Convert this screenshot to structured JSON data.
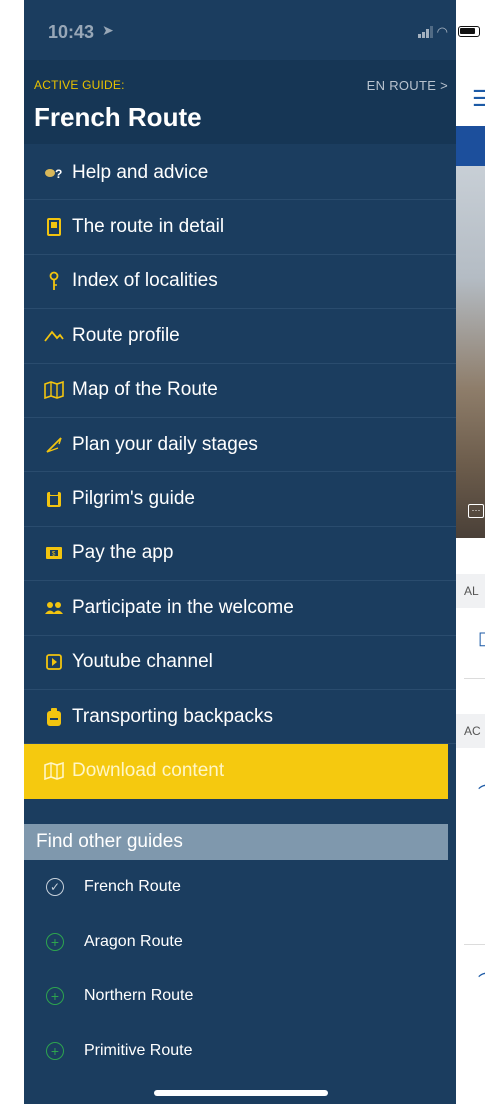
{
  "status_bar": {
    "time": "10:43"
  },
  "header": {
    "active_label": "ACTIVE GUIDE:",
    "en_route": "EN ROUTE >",
    "title": "French Route"
  },
  "menu": [
    {
      "label": "Help and advice",
      "icon": "help-icon"
    },
    {
      "label": "The route in detail",
      "icon": "route-detail-icon"
    },
    {
      "label": "Index of localities",
      "icon": "location-pin-icon"
    },
    {
      "label": "Route profile",
      "icon": "profile-icon"
    },
    {
      "label": "Map of the Route",
      "icon": "map-icon"
    },
    {
      "label": "Plan your daily stages",
      "icon": "plan-icon"
    },
    {
      "label": "Pilgrim's guide",
      "icon": "clipboard-icon"
    },
    {
      "label": "Pay the app",
      "icon": "money-icon"
    },
    {
      "label": "Participate in the welcome",
      "icon": "people-icon"
    },
    {
      "label": "Youtube channel",
      "icon": "play-icon"
    },
    {
      "label": "Transporting backpacks",
      "icon": "backpack-icon"
    },
    {
      "label": "Download content",
      "icon": "map-icon",
      "active": true
    }
  ],
  "find_other": {
    "header": "Find other guides",
    "guides": [
      {
        "label": "French Route",
        "icon": "check-circle-icon"
      },
      {
        "label": "Aragon Route",
        "icon": "plus-circle-icon"
      },
      {
        "label": "Northern Route",
        "icon": "plus-circle-icon"
      },
      {
        "label": "Primitive Route",
        "icon": "plus-circle-icon"
      }
    ]
  },
  "background_app": {
    "section_1": "AL",
    "section_2": "AC"
  },
  "colors": {
    "drawer_bg": "#1b3d5f",
    "accent_yellow": "#f5c90f",
    "find_header_bg": "#7f98ad",
    "plus_green": "#2da44e"
  }
}
